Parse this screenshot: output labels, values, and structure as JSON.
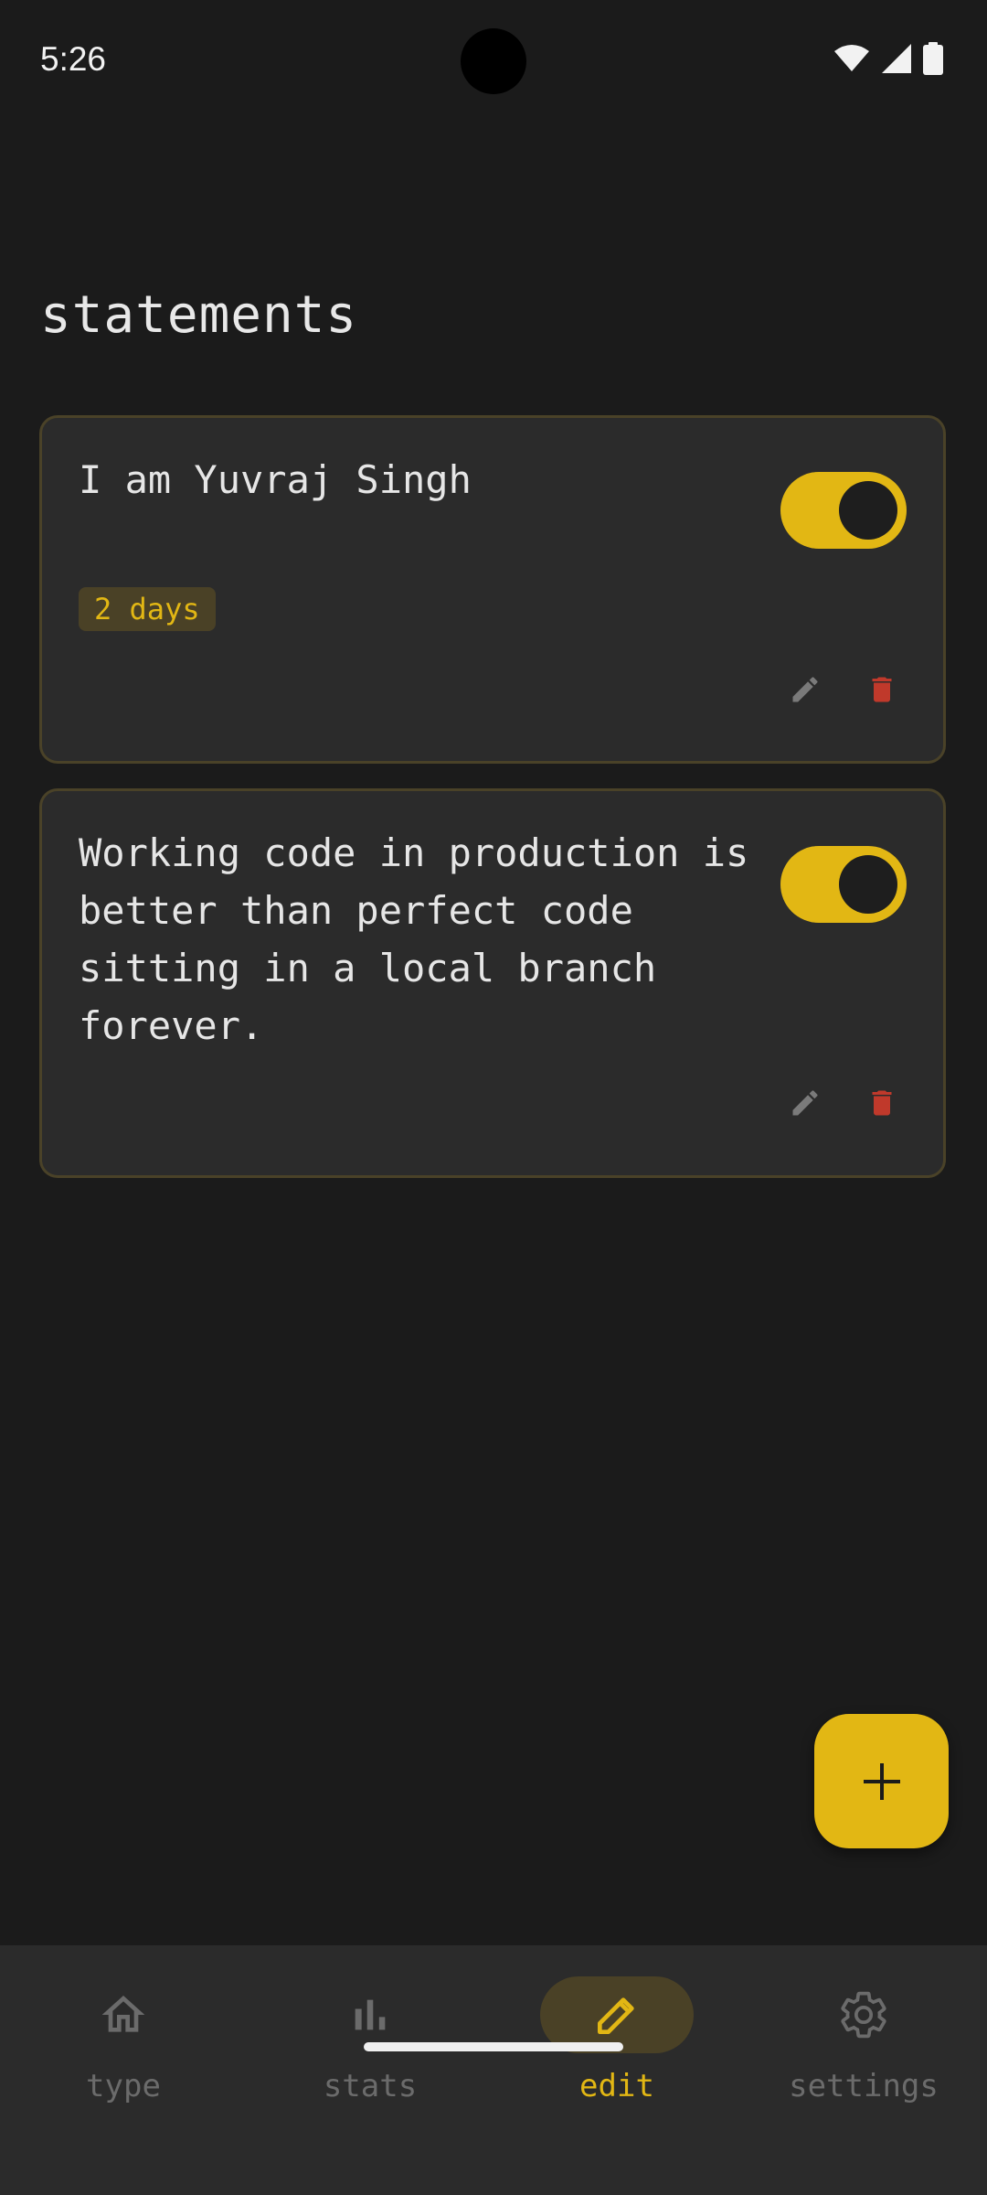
{
  "status_bar": {
    "time": "5:26",
    "icons": [
      "wifi-icon",
      "signal-icon",
      "battery-icon"
    ]
  },
  "page": {
    "title": "statements"
  },
  "statements": [
    {
      "text": "I am Yuvraj Singh",
      "badge": "2 days",
      "enabled": true
    },
    {
      "text": "Working code in production is\nbetter than perfect code\nsitting in a local branch\nforever.",
      "enabled": true
    }
  ],
  "card_actions": [
    "pencil-icon",
    "trash-icon"
  ],
  "fab": {
    "icon": "plus-icon"
  },
  "bottom_nav": {
    "items": [
      {
        "label": "type",
        "icon": "home-icon",
        "active": false
      },
      {
        "label": "stats",
        "icon": "bar-chart-icon",
        "active": false
      },
      {
        "label": "edit",
        "icon": "pencil-icon",
        "active": true
      },
      {
        "label": "settings",
        "icon": "gear-icon",
        "active": false
      }
    ]
  },
  "colors": {
    "background": "#1b1b1b",
    "surface": "#2b2b2b",
    "accent": "#e2b714",
    "accent_dim": "#4a4126",
    "danger": "#c0392b",
    "muted": "#6b6b6b"
  }
}
